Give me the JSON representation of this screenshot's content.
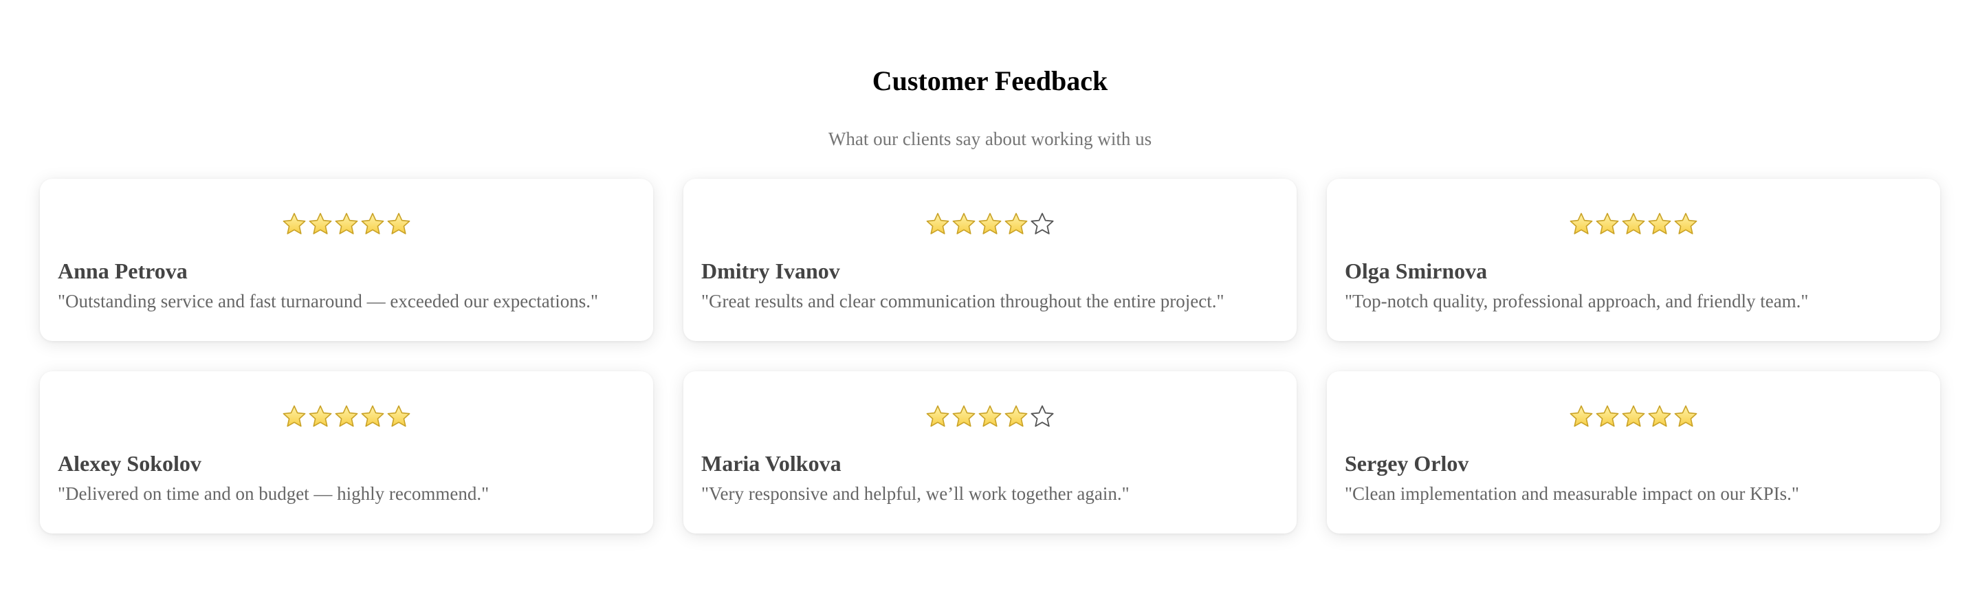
{
  "header": {
    "title": "Customer Feedback",
    "subtitle": "What our clients say about working with us"
  },
  "colors": {
    "star_fill": "#f7cf47",
    "star_fill_light": "#fff2a8",
    "star_stroke": "#c9a227",
    "empty_star_stroke": "#555555"
  },
  "rating_max": 5,
  "testimonials": [
    {
      "name": "Anna Petrova",
      "rating": 5,
      "text": "\"Outstanding service and fast turnaround — exceeded our expectations.\""
    },
    {
      "name": "Dmitry Ivanov",
      "rating": 4,
      "text": "\"Great results and clear communication throughout the entire project.\""
    },
    {
      "name": "Olga Smirnova",
      "rating": 5,
      "text": "\"Top-notch quality, professional approach, and friendly team.\""
    },
    {
      "name": "Alexey Sokolov",
      "rating": 5,
      "text": "\"Delivered on time and on budget — highly recommend.\""
    },
    {
      "name": "Maria Volkova",
      "rating": 4,
      "text": "\"Very responsive and helpful, we’ll work together again.\""
    },
    {
      "name": "Sergey Orlov",
      "rating": 5,
      "text": "\"Clean implementation and measurable impact on our KPIs.\""
    }
  ]
}
